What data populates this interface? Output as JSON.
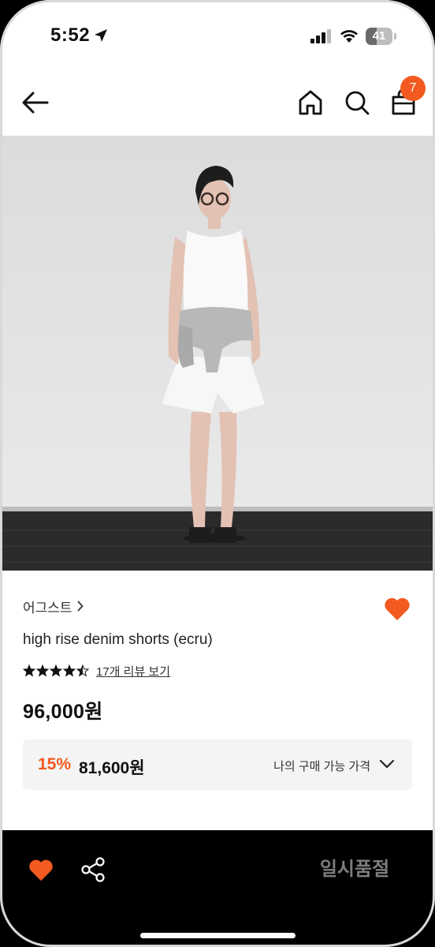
{
  "status_bar": {
    "time": "5:52",
    "battery": "41",
    "battery_level": 0.41
  },
  "nav": {
    "cart_count": "7"
  },
  "product": {
    "brand": "어그스트",
    "title": "high rise denim shorts (ecru)",
    "rating": 4.5,
    "review_link": "17개 리뷰 보기",
    "price": "96,000원",
    "discount": {
      "rate": "15%",
      "price": "81,600원",
      "label": "나의 구매 가능 가격"
    }
  },
  "bottom_bar": {
    "soldout_label": "일시품절"
  },
  "colors": {
    "accent": "#f25a1f",
    "bottom_bar": "#000000",
    "discount_box": "#f4f4f4"
  }
}
